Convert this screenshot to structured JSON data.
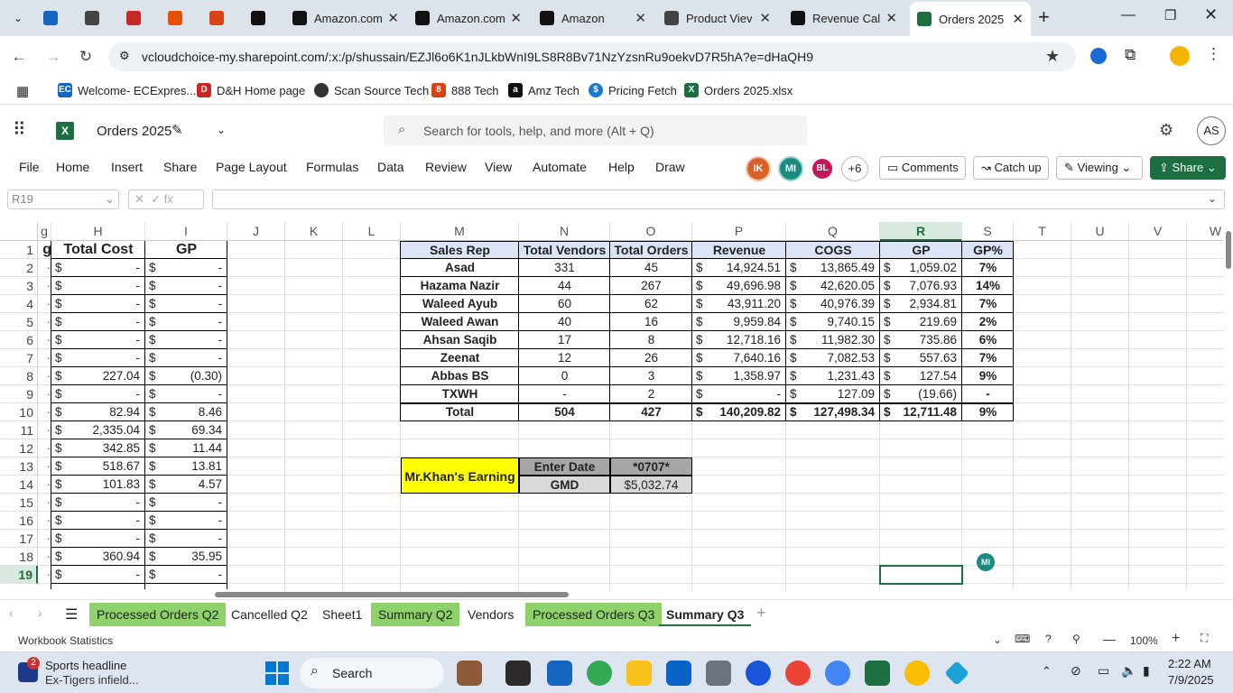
{
  "browser": {
    "tabs": [
      {
        "label": "",
        "icon": "ec-icon"
      },
      {
        "label": "",
        "icon": "globe-icon"
      },
      {
        "label": "",
        "icon": "dh-icon"
      },
      {
        "label": "",
        "icon": "s-icon"
      },
      {
        "label": "",
        "icon": "888-icon"
      },
      {
        "label": "",
        "icon": "amazon-icon"
      },
      {
        "label": "Amazon.com",
        "icon": "amazon-icon"
      },
      {
        "label": "Amazon.com",
        "icon": "amazon-icon"
      },
      {
        "label": "Amazon",
        "icon": "amazon-icon"
      },
      {
        "label": "Product Viev",
        "icon": "globe-icon"
      },
      {
        "label": "Revenue Cal",
        "icon": "amazon-icon"
      },
      {
        "label": "Orders 2025",
        "icon": "excel-icon"
      }
    ],
    "url": "vcloudchoice-my.sharepoint.com/:x:/p/shussain/EZJl6o6K1nJLkbWnI9LS8R8Bv71NzYzsnRu9oekvD7R5hA?e=dHaQH9",
    "bookmarks": [
      "Welcome- ECExpres...",
      "D&H Home page",
      "Scan Source Tech",
      "888 Tech",
      "Amz Tech",
      "Pricing Fetch",
      "Orders 2025.xlsx"
    ]
  },
  "excel": {
    "file_name": "Orders 2025",
    "search_placeholder": "Search for tools, help, and more (Alt + Q)",
    "avatar": "AS",
    "menu": [
      "File",
      "Home",
      "Insert",
      "Share",
      "Page Layout",
      "Formulas",
      "Data",
      "Review",
      "View",
      "Automate",
      "Help",
      "Draw"
    ],
    "collab": [
      "IK",
      "MI",
      "BL",
      "+6"
    ],
    "comments": "Comments",
    "catchup": "Catch up",
    "viewing": "Viewing",
    "share": "Share",
    "name_box": "R19",
    "fx": "fx"
  },
  "grid": {
    "columns": [
      "g",
      "H",
      "I",
      "J",
      "K",
      "L",
      "M",
      "N",
      "O",
      "P",
      "Q",
      "R",
      "S",
      "T",
      "U",
      "V",
      "W"
    ],
    "rows": [
      "1",
      "2",
      "3",
      "4",
      "5",
      "6",
      "7",
      "8",
      "9",
      "10",
      "11",
      "12",
      "13",
      "14",
      "15",
      "16",
      "17",
      "18",
      "19"
    ],
    "left_table": {
      "headers": [
        "g",
        "Total Cost",
        "GP"
      ],
      "rows": [
        [
          "-",
          "-"
        ],
        [
          "-",
          "-"
        ],
        [
          "-",
          "-"
        ],
        [
          "-",
          "-"
        ],
        [
          "-",
          "-"
        ],
        [
          "-",
          "-"
        ],
        [
          "227.04",
          "(0.30)"
        ],
        [
          "-",
          "-"
        ],
        [
          "82.94",
          "8.46"
        ],
        [
          "2,335.04",
          "69.34"
        ],
        [
          "342.85",
          "11.44"
        ],
        [
          "518.67",
          "13.81"
        ],
        [
          "101.83",
          "4.57"
        ],
        [
          "-",
          "-"
        ],
        [
          "-",
          "-"
        ],
        [
          "-",
          "-"
        ],
        [
          "360.94",
          "35.95"
        ],
        [
          "-",
          "-"
        ]
      ]
    },
    "summary": {
      "headers": [
        "Sales Rep",
        "Total Vendors",
        "Total Orders",
        "Revenue",
        "COGS",
        "GP",
        "GP%"
      ],
      "rows": [
        [
          "Asad",
          "331",
          "45",
          "14,924.51",
          "13,865.49",
          "1,059.02",
          "7%"
        ],
        [
          "Hazama Nazir",
          "44",
          "267",
          "49,696.98",
          "42,620.05",
          "7,076.93",
          "14%"
        ],
        [
          "Waleed Ayub",
          "60",
          "62",
          "43,911.20",
          "40,976.39",
          "2,934.81",
          "7%"
        ],
        [
          "Waleed Awan",
          "40",
          "16",
          "9,959.84",
          "9,740.15",
          "219.69",
          "2%"
        ],
        [
          "Ahsan Saqib",
          "17",
          "8",
          "12,718.16",
          "11,982.30",
          "735.86",
          "6%"
        ],
        [
          "Zeenat",
          "12",
          "26",
          "7,640.16",
          "7,082.53",
          "557.63",
          "7%"
        ],
        [
          "Abbas BS",
          "0",
          "3",
          "1,358.97",
          "1,231.43",
          "127.54",
          "9%"
        ],
        [
          "TXWH",
          "-",
          "2",
          "-",
          "127.09",
          "(19.66)",
          "-"
        ],
        [
          "Total",
          "504",
          "427",
          "140,209.82",
          "127,498.34",
          "12,711.48",
          "9%"
        ]
      ]
    },
    "earning": {
      "label": "Mr.Khan's Earning",
      "enter_date": "Enter Date",
      "date_value": "*0707*",
      "gmd": "GMD",
      "gmd_value": "$5,032.74"
    },
    "presence": "MI",
    "currency": "$"
  },
  "sheets": [
    {
      "label": "Processed Orders Q2",
      "style": "green"
    },
    {
      "label": "Cancelled Q2",
      "style": "plain"
    },
    {
      "label": "Sheet1",
      "style": "plain"
    },
    {
      "label": "Summary Q2",
      "style": "green"
    },
    {
      "label": "Vendors",
      "style": "plain"
    },
    {
      "label": "Processed Orders Q3",
      "style": "green"
    },
    {
      "label": "Summary Q3",
      "style": "active"
    }
  ],
  "status": {
    "left": "Workbook Statistics",
    "zoom": "100%"
  },
  "taskbar": {
    "news_badge": "2",
    "news_title": "Sports headline",
    "news_sub": "Ex-Tigers infield...",
    "search": "Search",
    "time": "2:22 AM",
    "date": "7/9/2025"
  }
}
